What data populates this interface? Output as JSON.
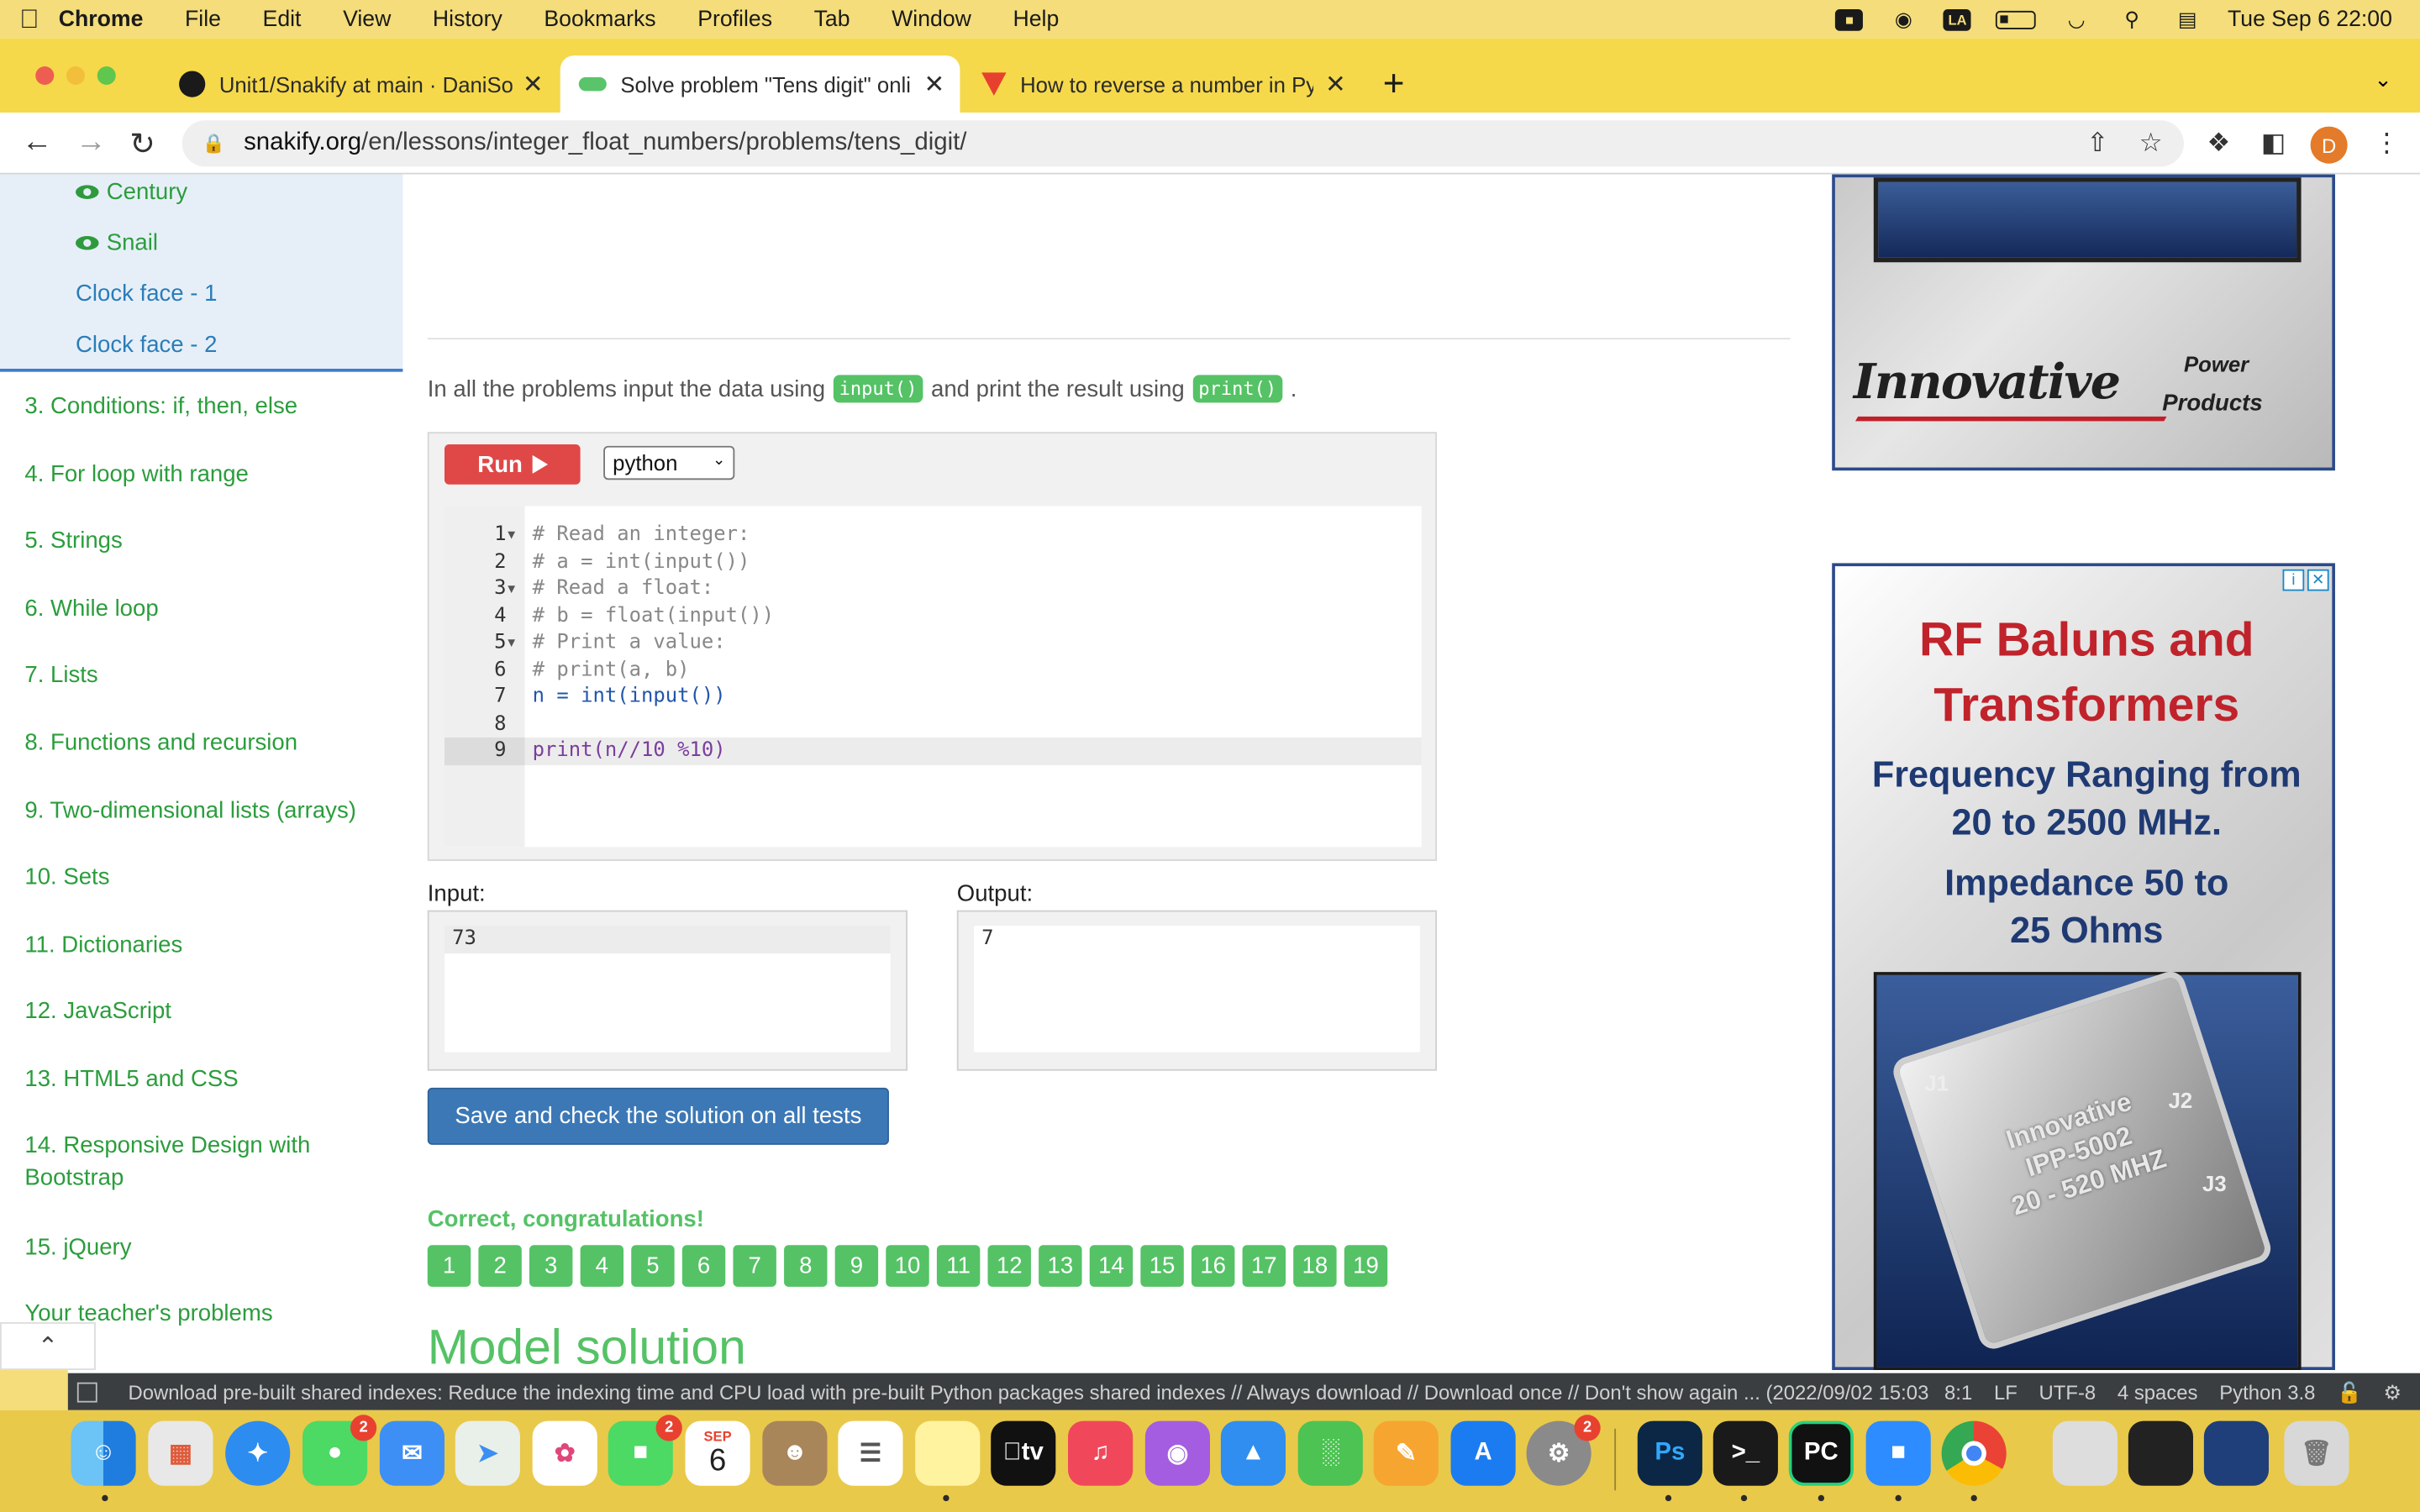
{
  "menubar": {
    "app": "Chrome",
    "items": [
      "File",
      "Edit",
      "View",
      "History",
      "Bookmarks",
      "Profiles",
      "Tab",
      "Window",
      "Help"
    ],
    "lang_badge": "LA",
    "datetime": "Tue Sep 6  22:00"
  },
  "tabs": [
    {
      "title": "Unit1/Snakify at main · DaniSof",
      "icon": "github-icon"
    },
    {
      "title": "Solve problem \"Tens digit\" onli",
      "icon": "snakify-icon"
    },
    {
      "title": "How to reverse a number in Py",
      "icon": "vivaldi-icon"
    }
  ],
  "url": {
    "host": "snakify.org",
    "path": "/en/lessons/integer_float_numbers/problems/tens_digit/"
  },
  "profile_initial": "D",
  "sidebar": {
    "sub_items": [
      {
        "label": "Century",
        "seen": true
      },
      {
        "label": "Snail",
        "seen": true
      },
      {
        "label": "Clock face - 1",
        "seen": false
      },
      {
        "label": "Clock face - 2",
        "seen": false
      }
    ],
    "lessons": [
      "3. Conditions: if, then, else",
      "4. For loop with range",
      "5. Strings",
      "6. While loop",
      "7. Lists",
      "8. Functions and recursion",
      "9. Two-dimensional lists (arrays)",
      "10. Sets",
      "11. Dictionaries",
      "12. JavaScript",
      "13. HTML5 and CSS",
      "14. Responsive Design with Bootstrap",
      "15. jQuery",
      "Your teacher's problems"
    ]
  },
  "main": {
    "intro_pre": "In all the problems input the data using",
    "intro_input": "input()",
    "intro_mid": "and print the result using",
    "intro_print": "print()",
    "intro_post": ".",
    "run_label": "Run",
    "language": "python",
    "code": [
      "# Read an integer:",
      "# a = int(input())",
      "# Read a float:",
      "# b = float(input())",
      "# Print a value:",
      "# print(a, b)",
      "n = int(input())",
      "",
      "print(n//10 %10)"
    ],
    "input_label": "Input:",
    "output_label": "Output:",
    "input_value": "73",
    "output_value": "7",
    "save_label": "Save and check the solution on all tests",
    "result_text": "Correct, congratulations!",
    "tests": [
      "1",
      "2",
      "3",
      "4",
      "5",
      "6",
      "7",
      "8",
      "9",
      "10",
      "11",
      "12",
      "13",
      "14",
      "15",
      "16",
      "17",
      "18",
      "19"
    ],
    "model_solution_heading": "Model solution"
  },
  "ads": {
    "ad1": {
      "brand": "Innovative",
      "power": "Power",
      "products": "Products"
    },
    "ad2": {
      "line1": "RF Baluns and",
      "line2": "Transformers",
      "line3": "Frequency Ranging from",
      "line4": "20 to 2500 MHz.",
      "line5": "Impedance 50 to",
      "line6": "25 Ohms",
      "chip_text": [
        "Innovative",
        "IPP-5002",
        "20 - 520 MHZ"
      ],
      "pins": [
        "J1",
        "J2",
        "J3"
      ]
    }
  },
  "statusbar": {
    "message": "Download pre-built shared indexes: Reduce the indexing time and CPU load with pre-built Python packages shared indexes // Always download // Download once // Don't show again ... (2022/09/02 15:03",
    "position": "8:1",
    "line_sep": "LF",
    "encoding": "UTF-8",
    "indent": "4 spaces",
    "interpreter": "Python 3.8"
  },
  "dock": {
    "calendar_month": "SEP",
    "calendar_day": "6",
    "tv_label": "tv",
    "ps_label": "Ps",
    "pc_label": "PC",
    "terminal_label": ">_",
    "badges": {
      "messages": "2",
      "facetime": "2",
      "settings": "2"
    }
  }
}
